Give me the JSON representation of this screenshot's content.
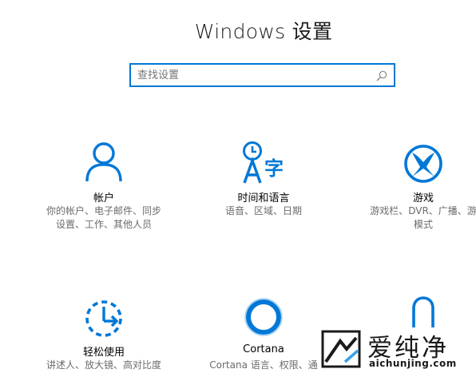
{
  "window": {
    "title": "Windows 设置"
  },
  "search": {
    "placeholder": "查找设置",
    "value": ""
  },
  "accent": "#0078d7",
  "tiles": [
    {
      "icon": "person-icon",
      "name": "帐户",
      "desc1": "你的帐户、电子邮件、同步",
      "desc2": "设置、工作、其他人员"
    },
    {
      "icon": "time-language-icon",
      "name": "时间和语言",
      "desc1": "语音、区域、日期",
      "desc2": ""
    },
    {
      "icon": "xbox-icon",
      "name": "游戏",
      "desc1": "游戏栏、DVR、广播、游",
      "desc2": "模式"
    },
    {
      "icon": "ease-of-access-icon",
      "name": "轻松使用",
      "desc1": "讲述人、放大镜、高对比度",
      "desc2": ""
    },
    {
      "icon": "cortana-icon",
      "name": "Cortana",
      "desc1": "Cortana 语言、权限、通",
      "desc2": ""
    },
    {
      "icon": "lock-icon",
      "name": "",
      "desc1": "",
      "desc2": ""
    }
  ],
  "watermark": {
    "text": "爱纯净",
    "url": "aichunjing.com"
  }
}
